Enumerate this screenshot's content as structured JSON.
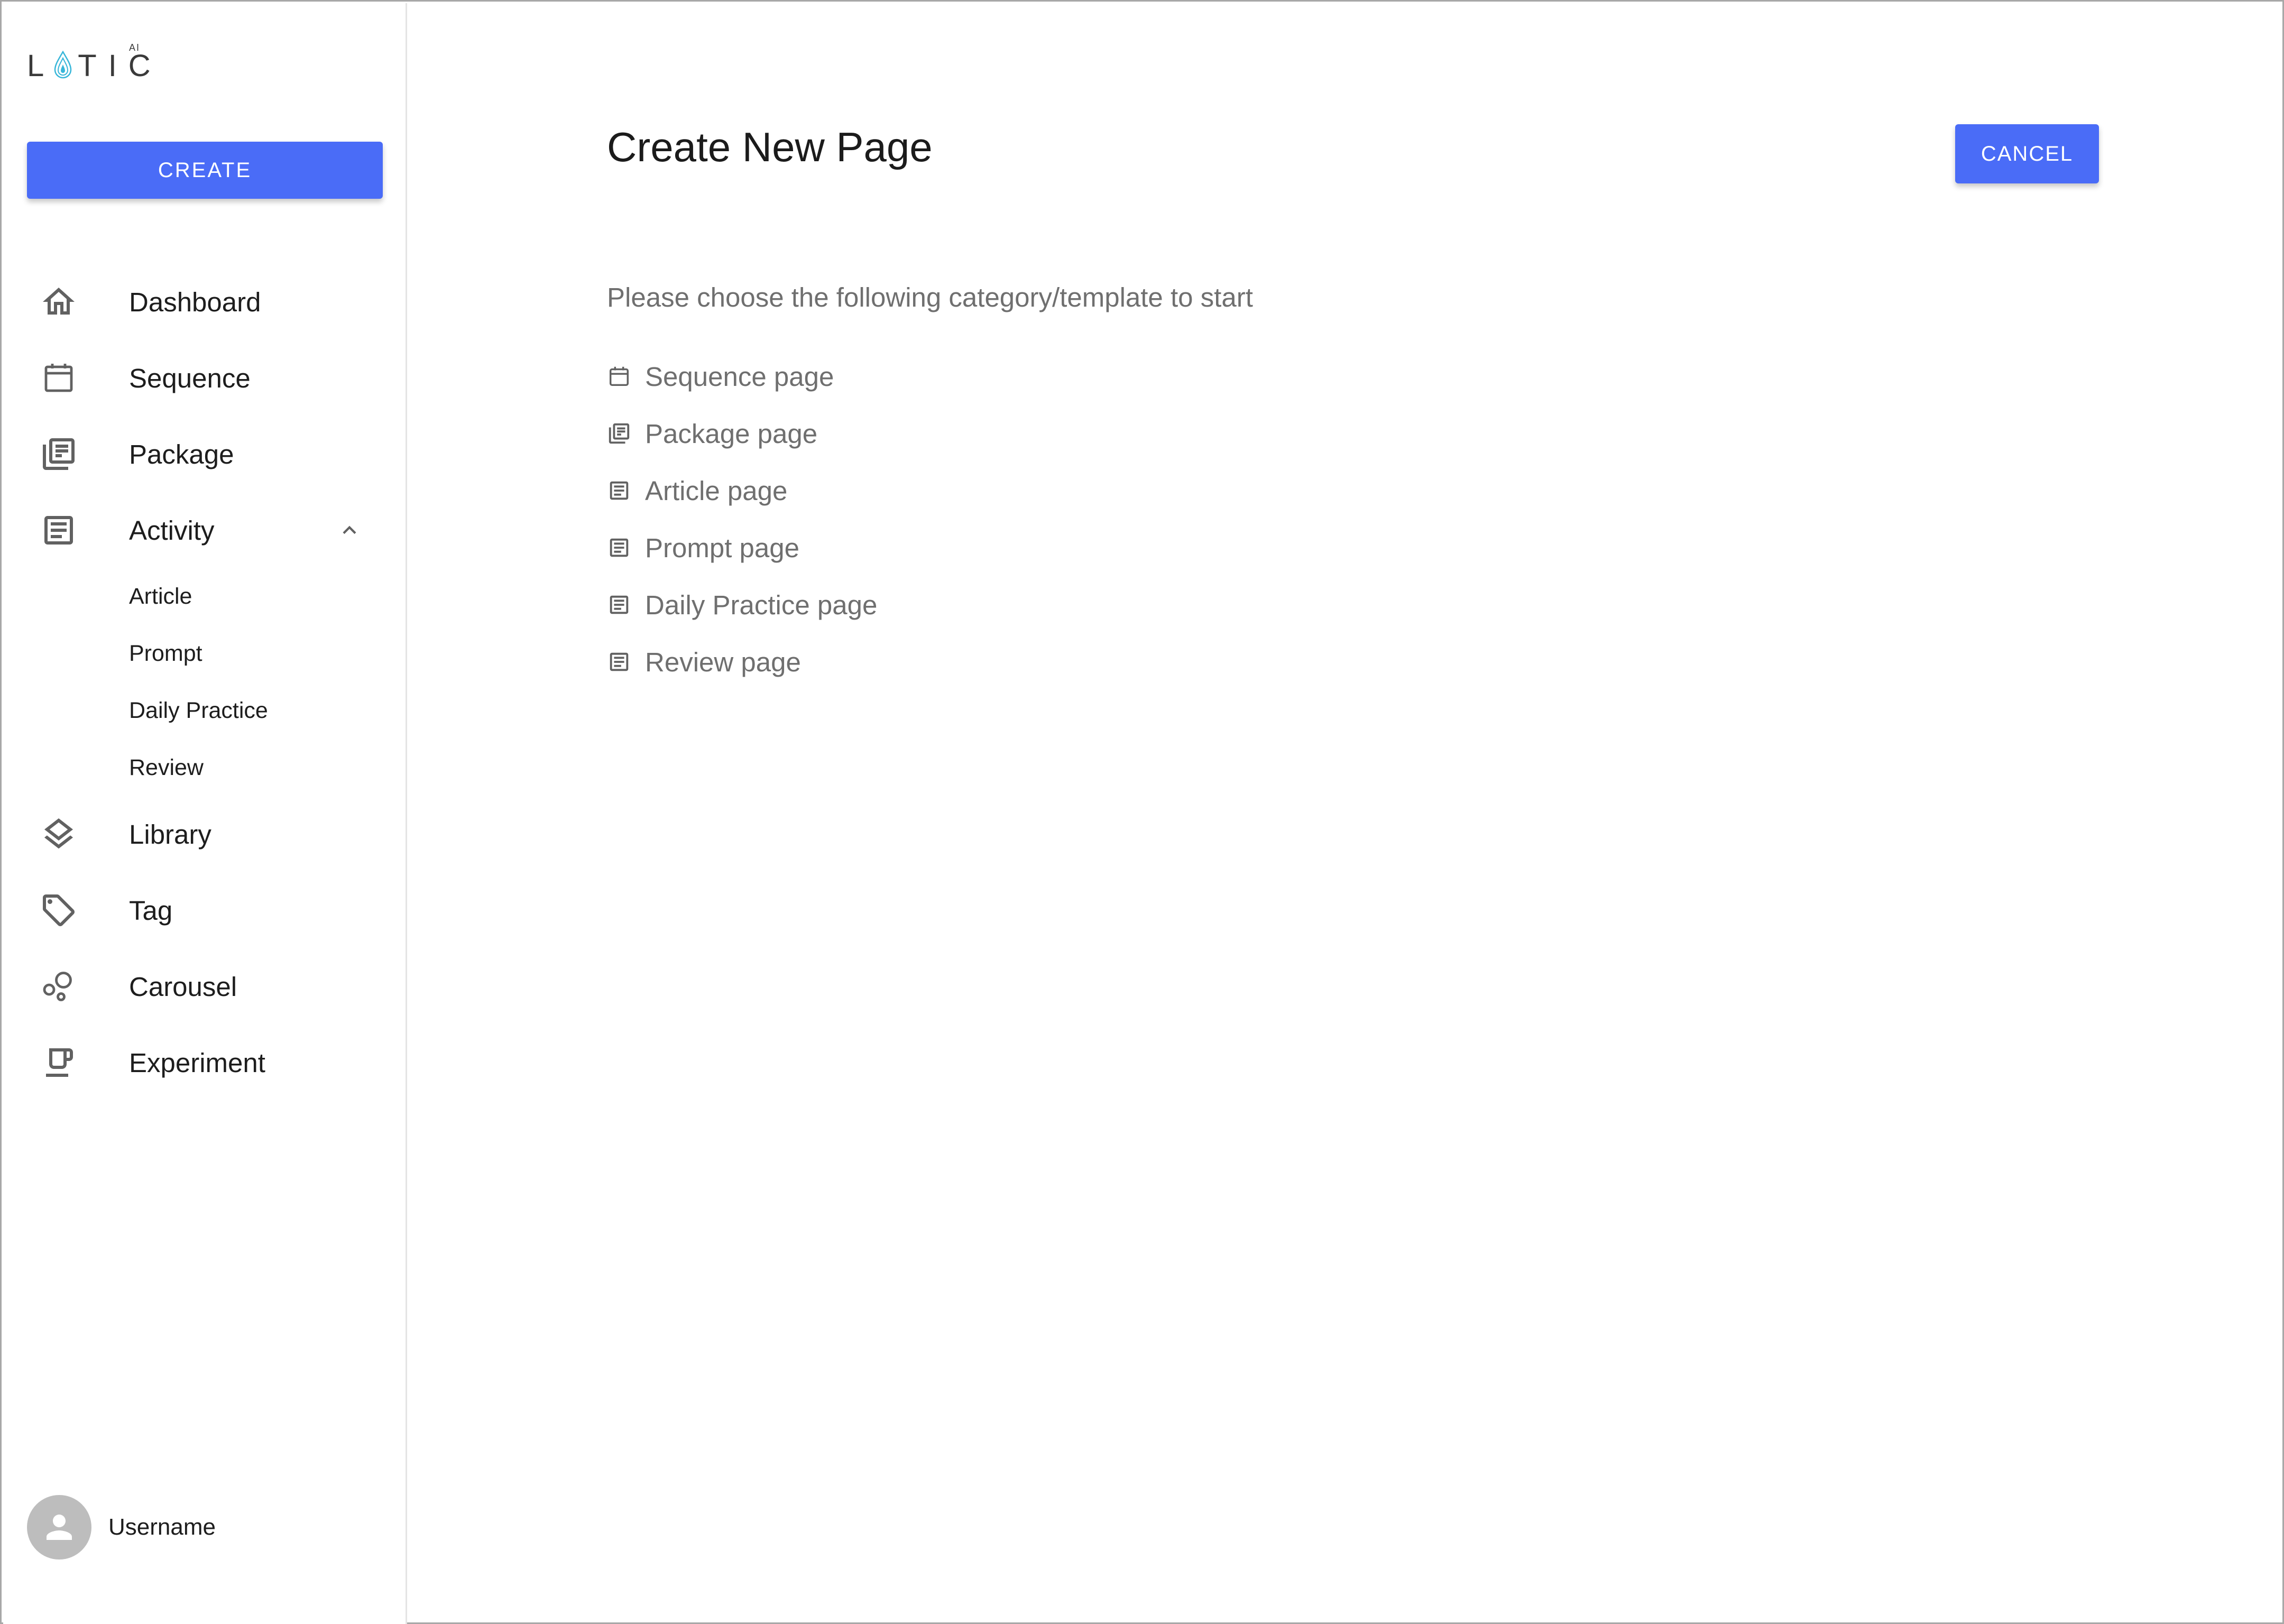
{
  "app": {
    "logo_text": "LOTIC",
    "logo_superscript": "AI"
  },
  "sidebar": {
    "create_label": "CREATE",
    "nav": [
      {
        "label": "Dashboard",
        "icon": "home-icon"
      },
      {
        "label": "Sequence",
        "icon": "calendar-icon"
      },
      {
        "label": "Package",
        "icon": "library-books-icon"
      },
      {
        "label": "Activity",
        "icon": "article-icon",
        "expanded": true,
        "children": [
          "Article",
          "Prompt",
          "Daily Practice",
          "Review"
        ]
      },
      {
        "label": "Library",
        "icon": "layers-icon"
      },
      {
        "label": "Tag",
        "icon": "tag-icon"
      },
      {
        "label": "Carousel",
        "icon": "bubbles-icon"
      },
      {
        "label": "Experiment",
        "icon": "coffee-icon"
      }
    ],
    "user": {
      "name": "Username",
      "icon": "person-icon"
    }
  },
  "main": {
    "title": "Create New Page",
    "cancel_label": "CANCEL",
    "instruction": "Please choose the following category/template to start",
    "templates": [
      {
        "label": "Sequence page",
        "icon": "calendar-icon"
      },
      {
        "label": "Package page",
        "icon": "library-books-icon"
      },
      {
        "label": "Article page",
        "icon": "article-icon"
      },
      {
        "label": "Prompt page",
        "icon": "article-icon"
      },
      {
        "label": "Daily Practice page",
        "icon": "article-icon"
      },
      {
        "label": "Review page",
        "icon": "article-icon"
      }
    ]
  },
  "colors": {
    "accent": "#4a6cf7",
    "logo_drop": "#37b6d9",
    "muted_text": "#6f6f6f"
  }
}
